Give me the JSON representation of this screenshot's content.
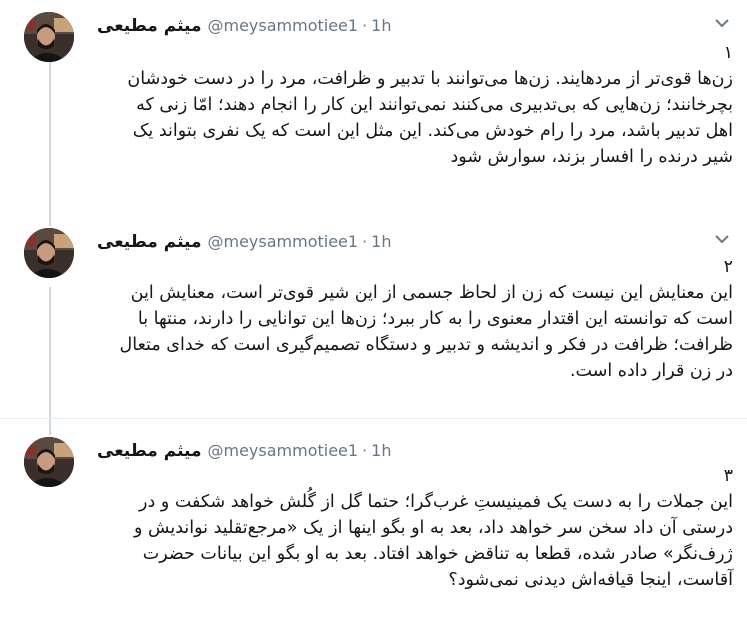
{
  "tweets": [
    {
      "name": "میثم مطیعی",
      "handle": "@meysammotiee1",
      "separator": "·",
      "time": "1h",
      "lines": [
        "۱",
        "زن‌ها قوی‌تر از مردهایند. زن‌ها می‌توانند با تدبیر و ظرافت، مرد را در دست خودشان",
        "بچرخانند؛ زن‌هایی که بی‌تدبیری می‌کنند نمی‌توانند این کار را انجام دهند؛ امّا زنی که",
        "اهل تدبیر باشد، مرد را رام خودش می‌کند. این مثل این است که یک نفری بتواند یک",
        "شیر درنده را افسار بزند، سوارش شود"
      ]
    },
    {
      "name": "میثم مطیعی",
      "handle": "@meysammotiee1",
      "separator": "·",
      "time": "1h",
      "lines": [
        "۲",
        "این معنایش این نیست که زن از لحاظ جسمی از این شیر قوی‌تر است، معنایش این",
        "است که توانسته این اقتدار معنوی را به کار ببرد؛ زن‌ها این توانایی را دارند، منتها با",
        "ظرافت؛ ظرافت در فکر و اندیشه و تدبیر و دستگاه تصمیم‌گیری است که خدای متعال",
        "در زن قرار داده است."
      ]
    },
    {
      "name": "میثم مطیعی",
      "handle": "@meysammotiee1",
      "separator": "·",
      "time": "1h",
      "lines": [
        "۳",
        "این جملات را به دست یک فمینیستِ غرب‌گرا؛ حتما گل از گُلش خواهد شکفت و در",
        "درستی آن داد سخن سر خواهد داد، بعد به او بگو اینها از یک «مرجع‌تقلید نواندیش و",
        "ژرف‌نگر» صادر شده، قطعا به تناقض خواهد افتاد. بعد به او بگو این بیانات حضرت",
        "آقاست، اینجا قیافه‌اش دیدنی نمی‌شود؟"
      ]
    }
  ],
  "icons": {
    "avatar": "avatar-photo",
    "menu": "chevron-down-icon"
  },
  "colors": {
    "text": "#14171a",
    "muted": "#657786",
    "thread": "#ccd6dd"
  }
}
